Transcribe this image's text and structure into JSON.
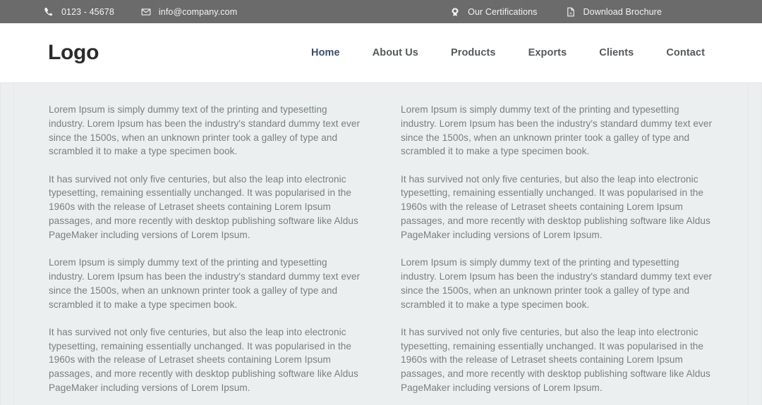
{
  "colors": {
    "topbar_bg": "#6b6b6b",
    "topbar_text": "#f4f4f4",
    "header_bg": "#ffffff",
    "logo_text": "#2b2b2b",
    "nav_text": "#55595c",
    "nav_active": "#3f4c6b",
    "body_bg": "#eceff0",
    "body_text": "#76807f"
  },
  "topbar": {
    "left_items": [
      {
        "icon": "phone-icon",
        "label": "0123 - 45678"
      },
      {
        "icon": "envelope-icon",
        "label": "info@company.com"
      }
    ],
    "right_items": [
      {
        "icon": "certificate-seal-icon",
        "label": "Our Certifications"
      },
      {
        "icon": "pdf-file-icon",
        "label": "Download Brochure"
      }
    ]
  },
  "header": {
    "logo": "Logo",
    "nav": [
      {
        "label": "Home",
        "active": true
      },
      {
        "label": "About Us",
        "active": false
      },
      {
        "label": "Products",
        "active": false
      },
      {
        "label": "Exports",
        "active": false
      },
      {
        "label": "Clients",
        "active": false
      },
      {
        "label": "Contact",
        "active": false
      }
    ]
  },
  "content": {
    "paragraph_a": "Lorem Ipsum is simply dummy text of the printing and typesetting industry. Lorem Ipsum has been the industry's standard dummy text ever since the 1500s, when an unknown printer took a galley of type and scrambled it to make a type specimen book.",
    "paragraph_b": "It has survived not only five centuries, but also the leap into electronic typesetting, remaining essentially unchanged. It was popularised in the 1960s with the release of Letraset sheets containing Lorem Ipsum passages, and more recently with desktop publishing software like Aldus PageMaker including versions of Lorem Ipsum.",
    "left_column": [
      "Lorem Ipsum is simply dummy text of the printing and typesetting industry. Lorem Ipsum has been the industry's standard dummy text ever since the 1500s, when an unknown printer took a galley of type and scrambled it to make a type specimen book.",
      "It has survived not only five centuries, but also the leap into electronic typesetting, remaining essentially unchanged. It was popularised in the 1960s with the release of Letraset sheets containing Lorem Ipsum passages, and more recently with desktop publishing software like Aldus PageMaker including versions of Lorem Ipsum.",
      "Lorem Ipsum is simply dummy text of the printing and typesetting industry. Lorem Ipsum has been the industry's standard dummy text ever since the 1500s, when an unknown printer took a galley of type and scrambled it to make a type specimen book.",
      "It has survived not only five centuries, but also the leap into electronic typesetting, remaining essentially unchanged. It was popularised in the 1960s with the release of Letraset sheets containing Lorem Ipsum passages, and more recently with desktop publishing software like Aldus PageMaker including versions of Lorem Ipsum."
    ],
    "right_column": [
      "Lorem Ipsum is simply dummy text of the printing and typesetting industry. Lorem Ipsum has been the industry's standard dummy text ever since the 1500s, when an unknown printer took a galley of type and scrambled it to make a type specimen book.",
      "It has survived not only five centuries, but also the leap into electronic typesetting, remaining essentially unchanged. It was popularised in the 1960s with the release of Letraset sheets containing Lorem Ipsum passages, and more recently with desktop publishing software like Aldus PageMaker including versions of Lorem Ipsum.",
      "Lorem Ipsum is simply dummy text of the printing and typesetting industry. Lorem Ipsum has been the industry's standard dummy text ever since the 1500s, when an unknown printer took a galley of type and scrambled it to make a type specimen book.",
      "It has survived not only five centuries, but also the leap into electronic typesetting, remaining essentially unchanged. It was popularised in the 1960s with the release of Letraset sheets containing Lorem Ipsum passages, and more recently with desktop publishing software like Aldus PageMaker including versions of Lorem Ipsum."
    ]
  }
}
